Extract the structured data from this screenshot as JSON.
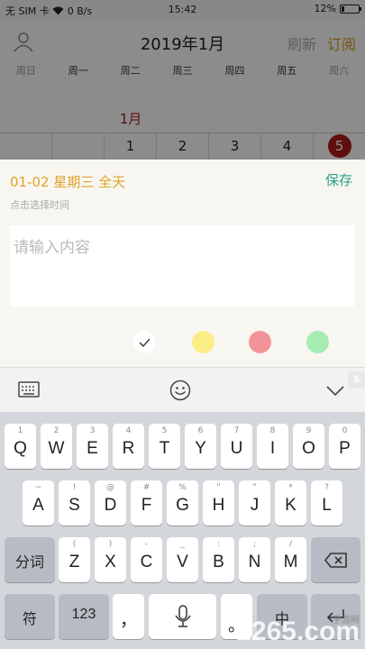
{
  "status_bar": {
    "left": "无 SIM 卡 ",
    "speed": "0 B/s",
    "time": "15:42",
    "battery": "12%"
  },
  "calendar": {
    "title": "2019年1月",
    "refresh": "刷新",
    "subscribe": "订阅",
    "weekdays": [
      "周日",
      "周一",
      "周二",
      "周三",
      "周四",
      "周五",
      "周六"
    ],
    "month_label": "1月",
    "dates": [
      "",
      "",
      "1",
      "2",
      "3",
      "4",
      "5"
    ]
  },
  "editor": {
    "date_line": "01-02 星期三  全天",
    "save": "保存",
    "hint": "点击选择时间",
    "placeholder": "请输入内容",
    "colors": {
      "white": "#ffffff",
      "yellow": "#fbee84",
      "red": "#f19397",
      "green": "#a6ecb1"
    }
  },
  "keyboard": {
    "row1": [
      {
        "sub": "1",
        "main": "Q"
      },
      {
        "sub": "2",
        "main": "W"
      },
      {
        "sub": "3",
        "main": "E"
      },
      {
        "sub": "4",
        "main": "R"
      },
      {
        "sub": "5",
        "main": "T"
      },
      {
        "sub": "6",
        "main": "Y"
      },
      {
        "sub": "7",
        "main": "U"
      },
      {
        "sub": "8",
        "main": "I"
      },
      {
        "sub": "9",
        "main": "O"
      },
      {
        "sub": "0",
        "main": "P"
      }
    ],
    "row2": [
      {
        "sub": "~",
        "main": "A"
      },
      {
        "sub": "!",
        "main": "S"
      },
      {
        "sub": "@",
        "main": "D"
      },
      {
        "sub": "#",
        "main": "F"
      },
      {
        "sub": "%",
        "main": "G"
      },
      {
        "sub": "\"",
        "main": "H"
      },
      {
        "sub": "\"",
        "main": "J"
      },
      {
        "sub": "*",
        "main": "K"
      },
      {
        "sub": "?",
        "main": "L"
      }
    ],
    "row3_left": "分词",
    "row3": [
      {
        "sub": "(",
        "main": "Z"
      },
      {
        "sub": ")",
        "main": "X"
      },
      {
        "sub": "-",
        "main": "C"
      },
      {
        "sub": "_",
        "main": "V"
      },
      {
        "sub": ":",
        "main": "B"
      },
      {
        "sub": ";",
        "main": "N"
      },
      {
        "sub": "/",
        "main": "M"
      }
    ],
    "row4": {
      "symbols": "符",
      "numbers": "123",
      "comma": "，",
      "lang": "中"
    }
  },
  "watermark": {
    "main": "2265.com",
    "sub": "手游网"
  }
}
